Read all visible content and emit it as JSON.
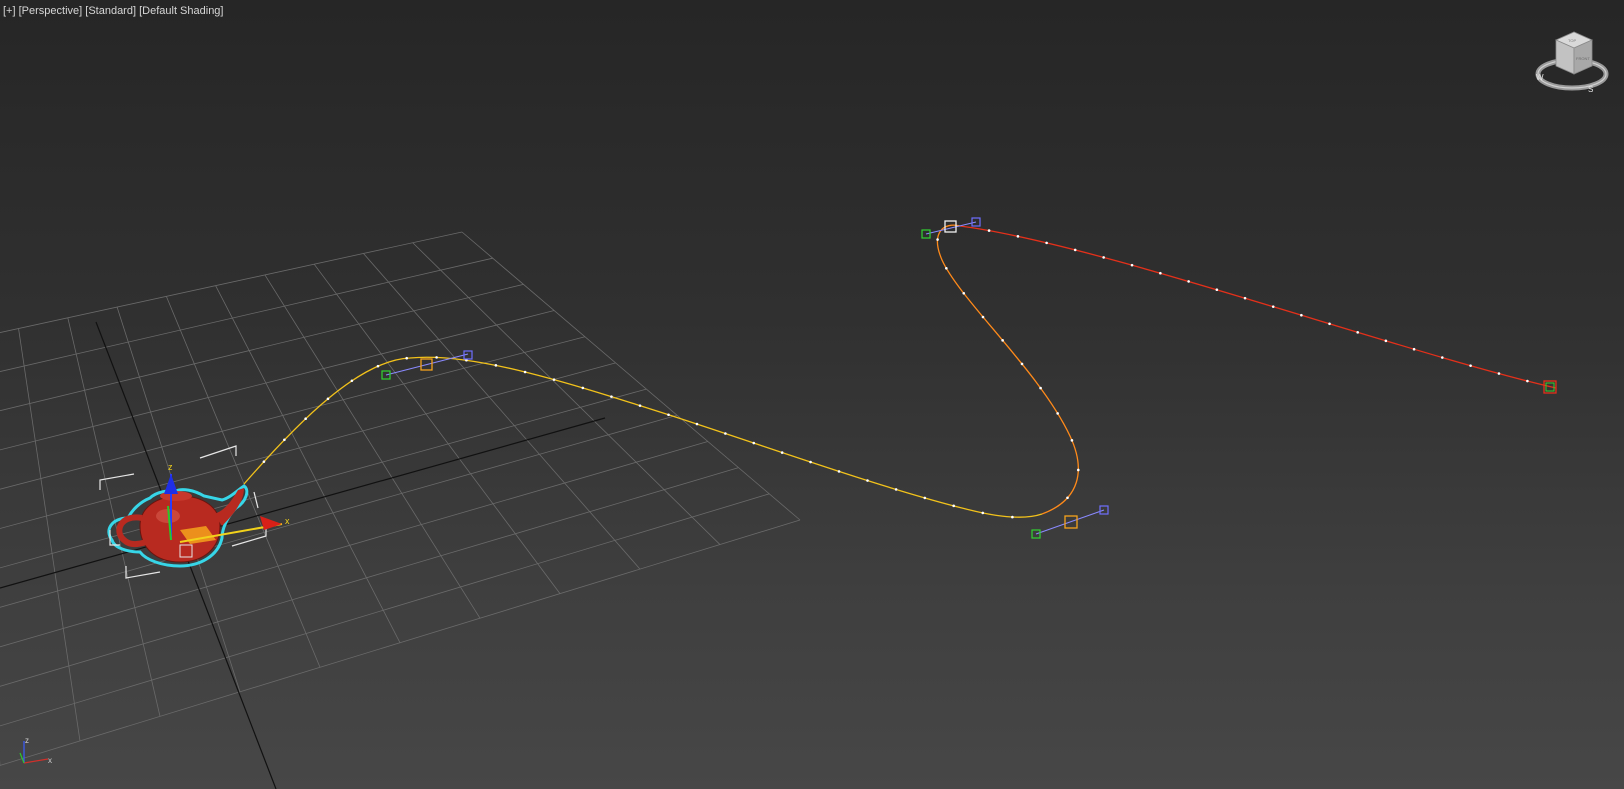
{
  "viewport": {
    "label_parts": [
      "[+]",
      "[Perspective]",
      "[Standard]",
      "[Default Shading]"
    ]
  },
  "gizmo": {
    "x_axis_label": "x",
    "z_axis_label": "z"
  },
  "tripod": {
    "x_label": "x",
    "z_label": "z"
  },
  "viewcube": {
    "compass_w": "W",
    "compass_s": "S",
    "face_label": "FRONT",
    "top_label": "TOP"
  },
  "colors": {
    "grid": "#6a6a6a",
    "grid_axis": "#111111",
    "path_yellow": "#f2c21b",
    "path_orange": "#ff8a1a",
    "path_red": "#e4301a",
    "vertex_selected": "#f5a21c",
    "handle_in": "#31d431",
    "handle_out": "#6f6fff",
    "teapot": "#b82a20",
    "selection_outline": "#37d6e8"
  },
  "icons": {
    "viewcube": "viewcube-icon",
    "teapot": "teapot-object",
    "tripod": "axis-tripod-icon"
  }
}
